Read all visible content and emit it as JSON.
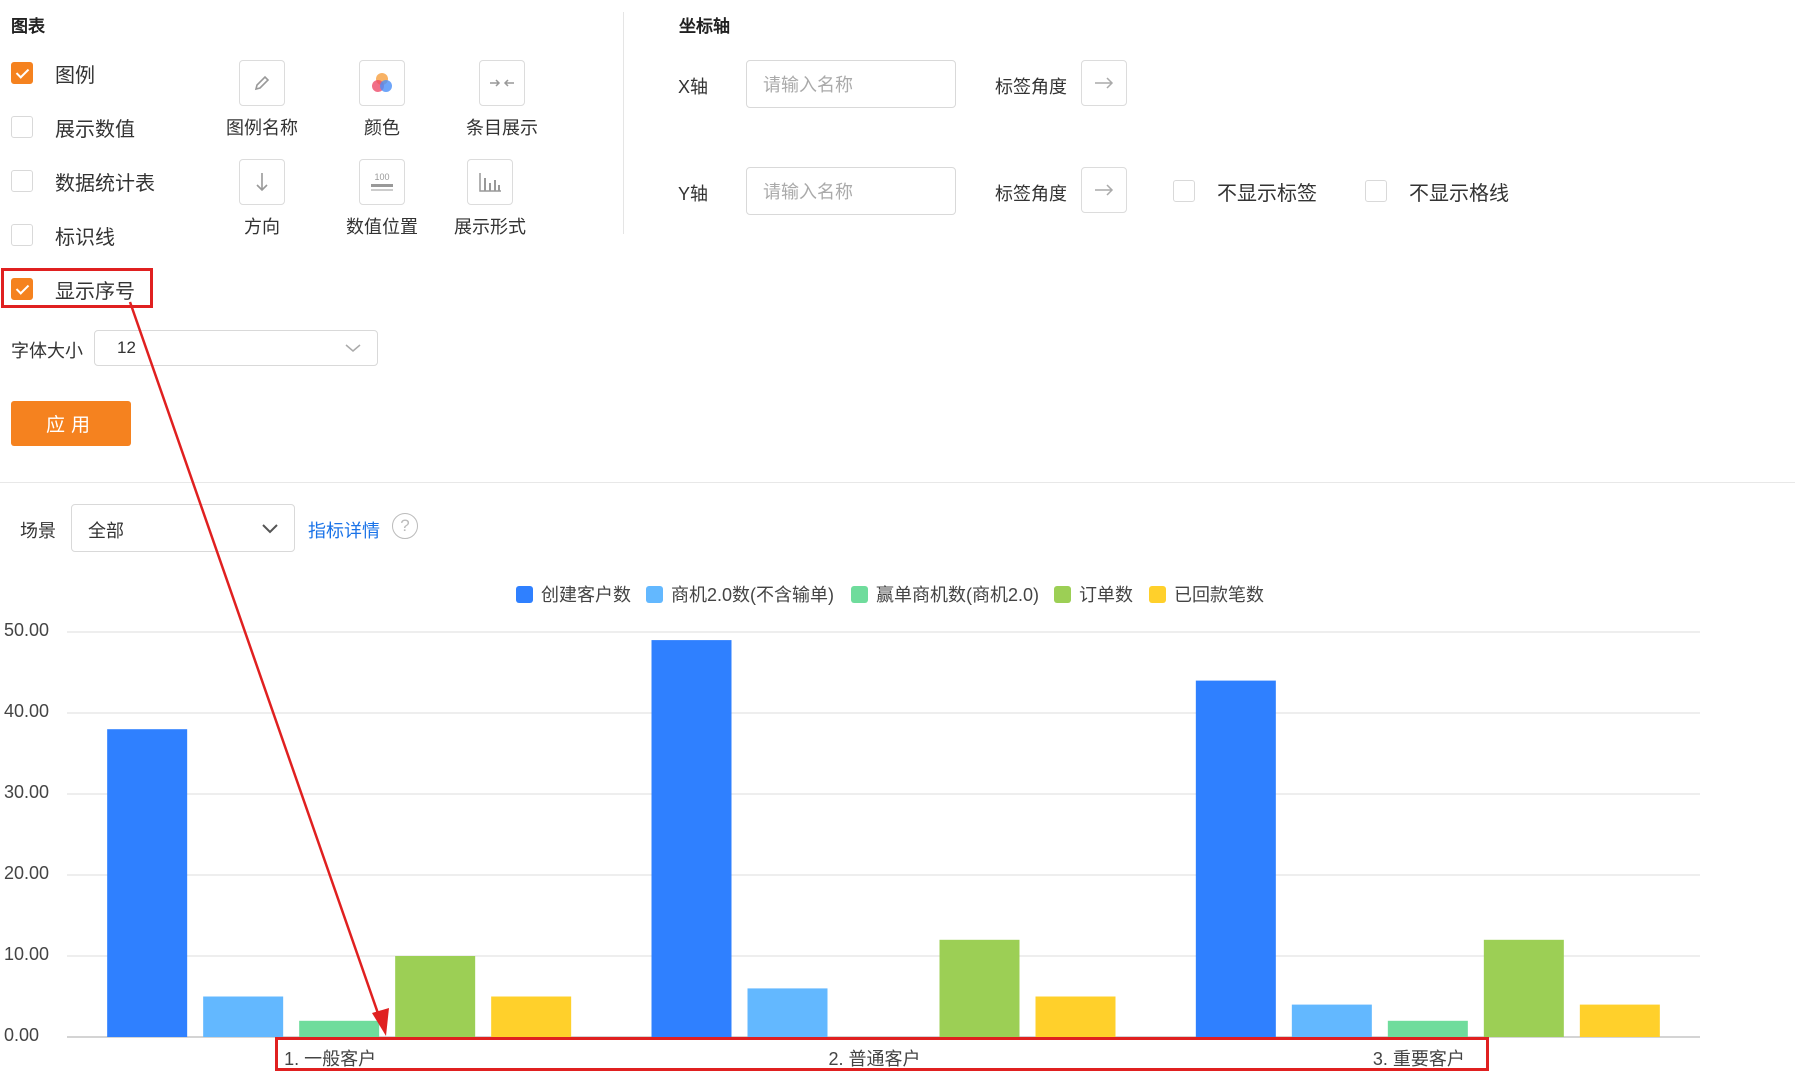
{
  "chart_panel": {
    "title": "图表",
    "options": [
      {
        "label": "图例",
        "checked": true
      },
      {
        "label": "展示数值",
        "checked": false
      },
      {
        "label": "数据统计表",
        "checked": false
      },
      {
        "label": "标识线",
        "checked": false
      },
      {
        "label": "显示序号",
        "checked": true
      }
    ],
    "tools": [
      {
        "label": "图例名称",
        "icon": "pencil-icon"
      },
      {
        "label": "颜色",
        "icon": "color-palette-icon"
      },
      {
        "label": "条目展示",
        "icon": "collapse-arrows-icon"
      },
      {
        "label": "方向",
        "icon": "arrow-down-icon"
      },
      {
        "label": "数值位置",
        "icon": "value-position-icon"
      },
      {
        "label": "展示形式",
        "icon": "bar-chart-icon"
      }
    ],
    "font_size_label": "字体大小",
    "font_size_value": "12",
    "apply_label": "应用"
  },
  "axis_panel": {
    "title": "坐标轴",
    "x_label": "X轴",
    "x_placeholder": "请输入名称",
    "x_angle_label": "标签角度",
    "y_label": "Y轴",
    "y_placeholder": "请输入名称",
    "y_angle_label": "标签角度",
    "hide_tick_labels": "不显示标签",
    "hide_grid_lines": "不显示格线"
  },
  "scene": {
    "label": "场景",
    "value": "全部",
    "detail_link": "指标详情",
    "help_icon": "?"
  },
  "colors": {
    "accent": "#f5821f",
    "annotation": "#e02020",
    "link": "#1a73e8"
  },
  "chart_data": {
    "type": "bar",
    "categories": [
      "1. 一般客户",
      "2. 普通客户",
      "3. 重要客户"
    ],
    "series": [
      {
        "name": "创建客户数",
        "color": "#2f80ff",
        "values": [
          38,
          49,
          44
        ]
      },
      {
        "name": "商机2.0数(不含输单)",
        "color": "#63b8ff",
        "values": [
          5,
          6,
          4
        ]
      },
      {
        "name": "赢单商机数(商机2.0)",
        "color": "#6fdc9c",
        "values": [
          2,
          0,
          2
        ]
      },
      {
        "name": "订单数",
        "color": "#9ccf55",
        "values": [
          10,
          12,
          12
        ]
      },
      {
        "name": "已回款笔数",
        "color": "#ffd02b",
        "values": [
          5,
          5,
          4
        ]
      }
    ],
    "yticks": [
      "0.00",
      "10.00",
      "20.00",
      "30.00",
      "40.00",
      "50.00"
    ],
    "ylim": [
      0,
      50
    ],
    "legend_position": "top-center",
    "grid": true
  }
}
